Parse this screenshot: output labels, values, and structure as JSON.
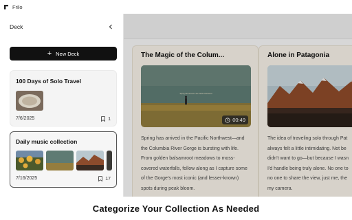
{
  "app": {
    "name": "Frilo"
  },
  "sidebar": {
    "title": "Deck",
    "new_deck_label": "New Deck",
    "decks": [
      {
        "title": "100 Days of Solo Travel",
        "date": "7/6/2025",
        "count": "1"
      },
      {
        "title": "Daily music collection",
        "date": "7/16/2025",
        "count": "17"
      }
    ]
  },
  "cards": [
    {
      "title": "The Magic of the Colum...",
      "duration": "00:49",
      "image_caption": "Spring has arrived in the Pacific Northwest",
      "text": [
        "Spring has arrived in the Pacific Northwest—and",
        "the Columbia River Gorge is bursting with life.",
        "From golden balsamroot meadows to moss-",
        "covered waterfalls, follow along as I capture some",
        "of the Gorge's most iconic (and lesser-known)",
        "spots during peak bloom."
      ]
    },
    {
      "title": "Alone in Patagonia",
      "text": [
        "The idea of traveling solo through Pat",
        "always felt a little intimidating. Not be",
        "didn't want to go—but because I wasn",
        "I'd handle being truly alone. No one to",
        "no one to share the view, just me, the",
        "my camera."
      ]
    }
  ],
  "caption": "Categorize Your Collection As Needed",
  "colors": {
    "accent": "#111111",
    "card_bg": "#f5f0e6",
    "overlay": "#e7e7e7"
  }
}
